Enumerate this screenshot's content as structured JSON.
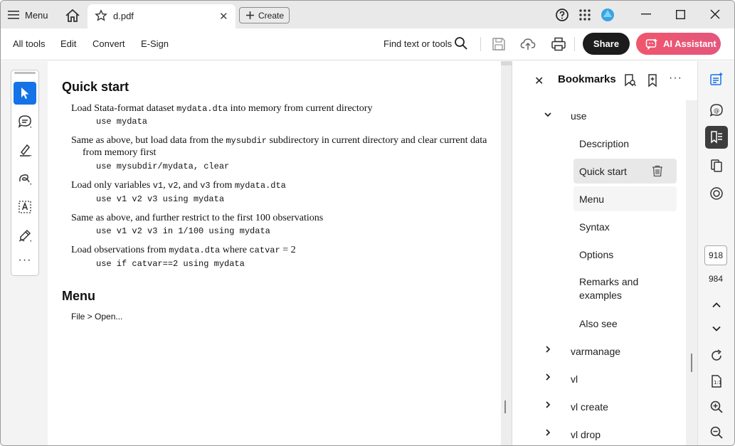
{
  "titlebar": {
    "menu_label": "Menu",
    "tab_title": "d.pdf",
    "tab_close": "✕",
    "create_label": "Create"
  },
  "toolbar": {
    "all_tools": "All tools",
    "edit": "Edit",
    "convert": "Convert",
    "esign": "E-Sign",
    "find": "Find text or tools",
    "share": "Share",
    "ai_assistant": "AI Assistant"
  },
  "document": {
    "quick_start_heading": "Quick start",
    "items": [
      {
        "desc_parts": [
          "Load Stata-format dataset ",
          "mydata.dta",
          " into memory from current directory"
        ],
        "code": "use mydata"
      },
      {
        "desc_line1_parts": [
          "Same as above, but load data from the ",
          "mysubdir",
          " subdirectory in current directory and clear current data"
        ],
        "desc_line2": "from memory first",
        "code": "use mysubdir/mydata, clear"
      },
      {
        "desc_parts": [
          "Load only variables ",
          "v1",
          ", ",
          "v2",
          ", and ",
          "v3",
          " from ",
          "mydata.dta"
        ],
        "code": "use v1 v2 v3 using mydata"
      },
      {
        "desc": "Same as above, and further restrict to the first 100 observations",
        "code": "use v1 v2 v3 in 1/100 using mydata"
      },
      {
        "desc_parts": [
          "Load observations from ",
          "mydata.dta",
          " where ",
          "catvar",
          " = 2"
        ],
        "code": "use if catvar==2 using mydata"
      }
    ],
    "menu_heading": "Menu",
    "menu_path": "File > Open..."
  },
  "bookmarks": {
    "title": "Bookmarks",
    "close": "✕",
    "more": "···",
    "expanded_item": "use",
    "children": [
      "Description",
      "Quick start",
      "Menu",
      "Syntax",
      "Options",
      "Remarks and examples",
      "Also see"
    ],
    "remarks_line1": "Remarks and",
    "remarks_line2": "examples",
    "selected": "Quick start",
    "siblings": [
      "varmanage",
      "vl",
      "vl create",
      "vl drop"
    ]
  },
  "pagenav": {
    "current_page": "918",
    "total_pages": "984"
  },
  "colors": {
    "accent_blue": "#1473e6",
    "share_bg": "#1c1c1c",
    "ai_gradient_start": "#f0566d",
    "ai_gradient_end": "#e3567d"
  }
}
